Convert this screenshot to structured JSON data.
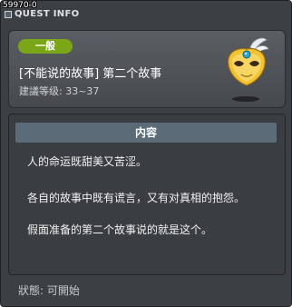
{
  "window": {
    "quest_id": "59970-0",
    "title": "QUEST INFO"
  },
  "header": {
    "category": "一般",
    "quest_name": "[不能说的故事] 第二个故事",
    "level_recommendation": "建議等级: 33~37"
  },
  "content": {
    "heading": "内容",
    "lines": [
      "人的命运既甜美又苦涩。",
      "各自的故事中既有谎言，又有对真相的抱怨。",
      "假面准备的第二个故事说的就是这个。"
    ]
  },
  "footer": {
    "status": "狀態: 可開始"
  },
  "colors": {
    "category_badge": "#7aa617",
    "window_bg": "#3c3f43",
    "content_header_bg": "#5b6c78"
  },
  "icons": {
    "title": "info-icon",
    "quest": "masquerade-mask-icon"
  }
}
